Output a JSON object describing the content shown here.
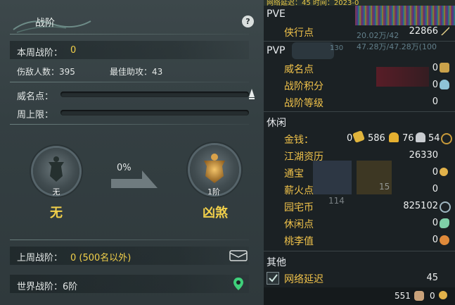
{
  "panel": {
    "title": "战阶",
    "help_label": "?",
    "weekly_rank_label": "本周战阶：",
    "weekly_rank_value": "0",
    "kills_label": "伤敌人数：395",
    "best_assist_label": "最佳助攻：43",
    "prestige_label": "威名点：",
    "weekly_cap_label": "周上限：",
    "progress_percent": "0%",
    "current_medal_small": "无",
    "current_medal_big": "无",
    "next_medal_small": "1阶",
    "next_medal_big": "凶煞",
    "last_week_label": "上周战阶：",
    "last_week_value": "0 (500名以外)",
    "world_rank_label": "世界战阶：6阶"
  },
  "stats": {
    "pve_header": "PVE",
    "xiaxing_label": "侠行点",
    "xiaxing_value": "22866",
    "pvp_header": "PVP",
    "weiming_label": "威名点",
    "weiming_value": "0",
    "zhanjie_score_label": "战阶积分",
    "zhanjie_score_value": "0",
    "zhanjie_level_label": "战阶等级",
    "zhanjie_level_value": "0",
    "leisure_header": "休闲",
    "money_label": "金钱：",
    "money_gold_ingot": "0",
    "money_gold": "586",
    "money_silver": "76",
    "money_copper": "54",
    "jianghu_label": "江湖资历",
    "jianghu_value": "26330",
    "tongbao_label": "通宝",
    "tongbao_value": "0",
    "xinhuo_label": "薪火点",
    "xinhuo_value": "0",
    "yuanzhai_label": "园宅币",
    "yuanzhai_value": "825102",
    "xiuxian_label": "休闲点",
    "xiuxian_value": "0",
    "taoli_label": "桃李值",
    "taoli_value": "0",
    "other_header": "其他",
    "latency_label": "网络延迟",
    "latency_value": "45",
    "latency_checked": true,
    "footer_left_value": "551",
    "footer_right_value": "0"
  },
  "background": {
    "top_banner_text": "网络延迟：45   时间：2023-0",
    "hp_text_1": "20.02万/42",
    "hp_text_2": "47.28万/47.28万(100",
    "level_text": "130",
    "bg_num_1": "15",
    "bg_num_2": "114"
  },
  "colors": {
    "label_yellow": "#f2d04a",
    "item_gold": "#f0c24a",
    "text_light": "#eef0f0"
  }
}
